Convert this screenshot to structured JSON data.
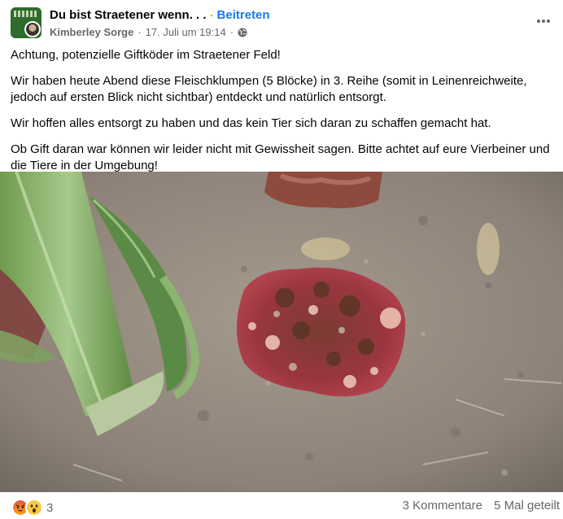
{
  "header": {
    "group_name": "Du bist Straetener wenn. . .",
    "separator": "·",
    "join_label": "Beitreten",
    "author": "Kimberley Sorge",
    "date": "17. Juli um 19:14",
    "privacy_icon": "globe-icon",
    "more_icon": "more-dots-icon"
  },
  "post": {
    "paragraphs": [
      "Achtung, potenzielle Giftköder im Straetener Feld!",
      "Wir haben heute Abend diese Fleischklumpen (5 Blöcke) in 3. Reihe (somit in Leinenreichweite, jedoch auf ersten Blick nicht sichtbar) entdeckt und natürlich entsorgt.",
      "Wir hoffen alles entsorgt zu haben und das kein Tier sich daran zu schaffen gemacht hat.",
      "Ob Gift daran war können wir leider nicht mit Gewissheit sagen. Bitte achtet auf eure Vierbeiner und die Tiere in der Umgebung!"
    ]
  },
  "footer": {
    "reaction_icons": [
      "angry-reaction-icon",
      "wow-reaction-icon"
    ],
    "reaction_count": "3",
    "comments": "3 Kommentare",
    "shares": "5 Mal geteilt"
  },
  "colors": {
    "link": "#1877f2",
    "meta": "#65676b",
    "text": "#050505"
  }
}
